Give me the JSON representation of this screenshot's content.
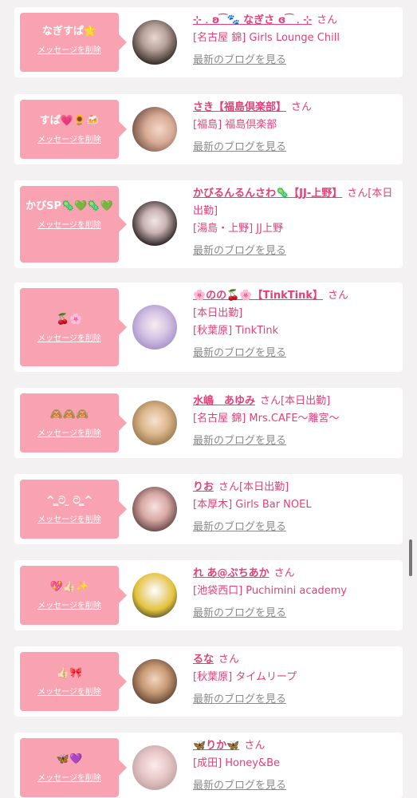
{
  "del_label": "メッセージを削除",
  "san": "さん",
  "blog_label": "最新のブログを見る",
  "cards": [
    {
      "nick": "なぎすぱ🌟",
      "name": "⊹﹒ʚ ͡ 🐾 なぎさ ɞ ͡ ﹒⊹",
      "status": "",
      "shop": "[名古屋 錦] Girls Lounge Chill"
    },
    {
      "nick": "すぱ💗🌻🍻",
      "name": "さき【福島倶楽部】",
      "status": "",
      "shop": "[福島] 福島倶楽部"
    },
    {
      "nick": "かびSP🦠💚🦠💚",
      "name": "かびるんるんさわ🦠【JJ-上野】",
      "status": "[本日出勤]",
      "shop": "[湯島・上野] JJ上野"
    },
    {
      "nick": "🍒🌸",
      "name": "🌸のの🍒🌸【TinkTink】",
      "status": "[本日出勤]",
      "shop": "[秋葉原] TinkTink"
    },
    {
      "nick": "🙈🙈🙈",
      "name": "水嶋　あゆみ",
      "status": "[本日出勤]",
      "shop": "[名古屋 錦] Mrs.CAFE〜離宮〜"
    },
    {
      "nick": "^ ̳ට ̫ ට ̳^",
      "name": "りお",
      "status": "[本日出勤]",
      "shop": "[本厚木] Girls Bar NOEL"
    },
    {
      "nick": "💖👍🏻✨",
      "name": "れ あ@ぷちあか",
      "status": "",
      "shop": "[池袋西口] Puchimini academy"
    },
    {
      "nick": "👍🏻🎀",
      "name": "るな",
      "status": "",
      "shop": "[秋葉原] タイムリープ"
    },
    {
      "nick": "🦋💜",
      "name": "🦋りか🦋",
      "status": "",
      "shop": "[成田] Honey&Be"
    }
  ],
  "colors": {
    "accent": "#e3407a",
    "bubble": "#f9a2b2"
  }
}
